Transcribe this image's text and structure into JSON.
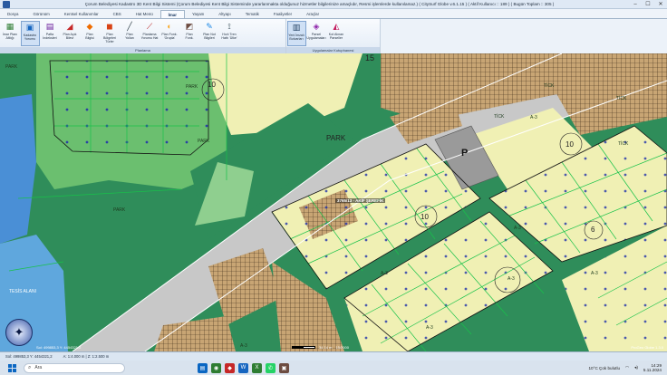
{
  "window": {
    "title": "Çorum Belediyesi Kadastro 3D Kent Bilgi Sistemi (Çorum Belediyesi Kent Bilgi Sisteminde yararlanmakta olduğunuz hizmetler bilgilerinize amaçlıdır, Resmi işlemlerde kullanılamaz.)  ( CitySurf Globe v.6.1.15 )  ( Aktif Kullanıcı :: 189 )  ( Bugün Toplam :: 305 )",
    "minimize": "–",
    "maximize": "☐",
    "close": "✕"
  },
  "menu_tabs": [
    {
      "label": "Dosya",
      "active": false
    },
    {
      "label": "Görünüm",
      "active": false
    },
    {
      "label": "Kentsel Kullanımlar",
      "active": false
    },
    {
      "label": "CBS",
      "active": false
    },
    {
      "label": "Hat Menü",
      "active": false
    },
    {
      "label": "İmar",
      "active": true
    },
    {
      "label": "Yaşam",
      "active": false
    },
    {
      "label": "Altyapı",
      "active": false
    },
    {
      "label": "Tematik",
      "active": false
    },
    {
      "label": "Faaliyetler",
      "active": false
    },
    {
      "label": "Araçlar",
      "active": false
    }
  ],
  "ribbon": {
    "groups": [
      {
        "label": "Planlama",
        "items": [
          {
            "label": "İmar Planı\nAltlığı",
            "icon": "map-layer-icon",
            "glyph": "▦",
            "color": "#2e7d32"
          },
          {
            "label": "Kadastro\nYorumu",
            "icon": "cadastre-icon",
            "glyph": "▣",
            "color": "#1565c0",
            "selected": true
          },
          {
            "label": "Pafta\nİndeksleri",
            "icon": "sheet-index-icon",
            "glyph": "▤",
            "color": "#6a1b9a"
          },
          {
            "label": "Plan Açık\nBilevi",
            "icon": "plan-open-icon",
            "glyph": "◢",
            "color": "#c62828"
          },
          {
            "label": "Plan\nBilgisi",
            "icon": "plan-info-icon",
            "glyph": "◆",
            "color": "#ef6c00"
          },
          {
            "label": "Plan Bölgeleri\nTürler",
            "icon": "plan-zones-icon",
            "glyph": "◼",
            "color": "#d84315"
          },
          {
            "label": "Plan\nYolları",
            "icon": "plan-roads-icon",
            "glyph": "╱",
            "color": "#37474f"
          },
          {
            "label": "Planlama\nYorumu Hat",
            "icon": "planning-line-icon",
            "glyph": "⟋",
            "color": "#b71c1c"
          },
          {
            "label": "Plan Fonk.\n'Grupla'",
            "icon": "plan-group-icon",
            "glyph": "◐",
            "color": "#f9a825"
          },
          {
            "label": "Plan\nFonk.",
            "icon": "plan-function-icon",
            "glyph": "◩",
            "color": "#6d4c41"
          },
          {
            "label": "Plan Not\nBilgileri",
            "icon": "plan-notes-icon",
            "glyph": "✎",
            "color": "#1e88e5"
          },
          {
            "label": "Hızlı Tren\nHattı 'Ülke'",
            "icon": "rail-icon",
            "glyph": "⟟",
            "color": "#455a64"
          }
        ]
      },
      {
        "label": "Uygulamalar Kutuphanesi",
        "items": [
          {
            "label": "Yeni İmzalı\nBulvarları",
            "icon": "building-icon",
            "glyph": "▥",
            "color": "#1b3a5c",
            "selected": true
          },
          {
            "label": "Parsel\nUygulamaları",
            "icon": "parcel-app-icon",
            "glyph": "◈",
            "color": "#8e24aa"
          },
          {
            "label": "Kot Alınan\nParseller",
            "icon": "elevation-icon",
            "glyph": "◭",
            "color": "#c2185b"
          }
        ]
      }
    ]
  },
  "map": {
    "labels": {
      "park_1": "PARK",
      "park_2": "PARK",
      "park_3": "PARK",
      "park_4": "PARK",
      "park_5": "PARK",
      "parking": "P",
      "block_15": "15",
      "block_10a": "10",
      "block_10b": "10",
      "block_10c": "10",
      "block_6": "6",
      "tick_1": "TİCK",
      "tick_2": "TİCK",
      "tick_3": "TİCK",
      "tick_4": "TİCK",
      "a3_1": "A-3",
      "a3_2": "A-3",
      "a3_3": "A-3",
      "a3_4": "A-3",
      "a3_5": "A-3",
      "a3_6": "A-3",
      "a3_7": "A-3",
      "parcel_tag": "3765/13 - AKİF ŞEREFİK",
      "left_area": "TESİS ALANI"
    },
    "colors": {
      "park": "#2f8d5a",
      "residential": "#f0f0b4",
      "hatched": "#c8a574",
      "road": "#c8c8c8",
      "water": "#4a8fd6",
      "boundary": "#18c24a"
    }
  },
  "statusbar": {
    "left": "Sol: 499853,3  Y: 4454321,2",
    "mid": "A: 1:4.000 m   |   Z: 1:2.500 m",
    "scale": "34.14 m",
    "scale_right": "15/2000",
    "attr": "ProGeo Globe 1.3.0"
  },
  "taskbar": {
    "search_placeholder": "Ara",
    "weather": "10°C  Çok bulutlu",
    "time": "14:29",
    "date": "5.11.2024"
  }
}
